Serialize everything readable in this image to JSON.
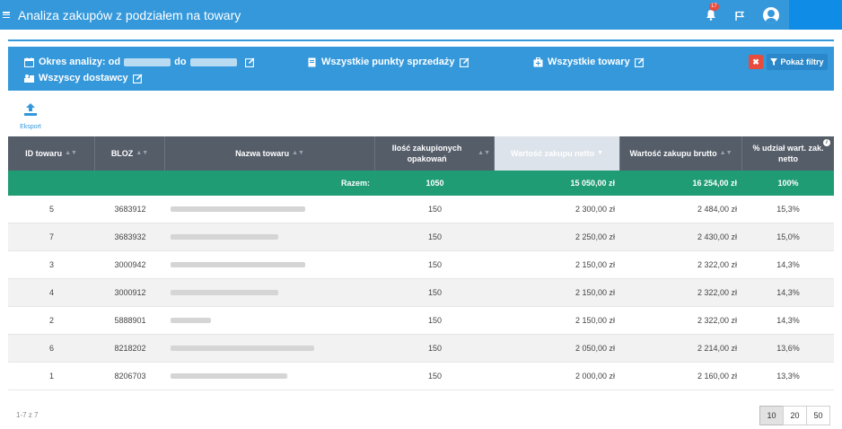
{
  "header": {
    "title": "Analiza zakupów z podziałem na towary",
    "notification_count": "17"
  },
  "filters": {
    "period_label": "Okres analizy: od",
    "period_to": "do",
    "points_of_sale": "Wszystkie punkty sprzedaży",
    "goods": "Wszystkie towary",
    "suppliers": "Wszyscy dostawcy",
    "show_filters": "Pokaż filtry",
    "clear": "✖"
  },
  "toolbar": {
    "export_label": "Eksport"
  },
  "table": {
    "columns": [
      "ID towaru",
      "BLOZ",
      "Nazwa towaru",
      "Ilość zakupionych opakowań",
      "Wartość zakupu netto",
      "Wartość zakupu brutto",
      "% udział wart. zak. netto"
    ],
    "summary": {
      "label": "Razem:",
      "qty": "1050",
      "net": "15 050,00 zł",
      "gross": "16 254,00 zł",
      "share": "100%"
    },
    "rows": [
      {
        "id": "5",
        "bloz": "3683912",
        "qty": "150",
        "net": "2 300,00 zł",
        "gross": "2 484,00 zł",
        "share": "15,3%"
      },
      {
        "id": "7",
        "bloz": "3683932",
        "qty": "150",
        "net": "2 250,00 zł",
        "gross": "2 430,00 zł",
        "share": "15,0%"
      },
      {
        "id": "3",
        "bloz": "3000942",
        "qty": "150",
        "net": "2 150,00 zł",
        "gross": "2 322,00 zł",
        "share": "14,3%"
      },
      {
        "id": "4",
        "bloz": "3000912",
        "qty": "150",
        "net": "2 150,00 zł",
        "gross": "2 322,00 zł",
        "share": "14,3%"
      },
      {
        "id": "2",
        "bloz": "5888901",
        "qty": "150",
        "net": "2 150,00 zł",
        "gross": "2 322,00 zł",
        "share": "14,3%"
      },
      {
        "id": "6",
        "bloz": "8218202",
        "qty": "150",
        "net": "2 050,00 zł",
        "gross": "2 214,00 zł",
        "share": "13,6%"
      },
      {
        "id": "1",
        "bloz": "8206703",
        "qty": "150",
        "net": "2 000,00 zł",
        "gross": "2 160,00 zł",
        "share": "13,3%"
      }
    ]
  },
  "footer": {
    "count": "1-7 z 7",
    "page_sizes": [
      "10",
      "20",
      "50"
    ],
    "active_page_size": "10"
  },
  "colors": {
    "primary": "#3498db",
    "summary_row": "#1f9c73",
    "header_row": "#555d69",
    "danger": "#e74c3c"
  }
}
